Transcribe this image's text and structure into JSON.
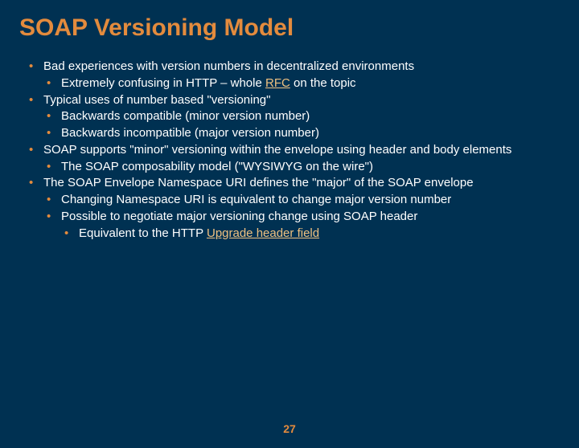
{
  "title": "SOAP Versioning Model",
  "b": {
    "i1": "Bad experiences with version numbers in decentralized environments",
    "i1a_pre": "Extremely confusing in HTTP – whole ",
    "i1a_link": "RFC",
    "i1a_post": " on the topic",
    "i2": "Typical uses of number based \"versioning\"",
    "i2a": "Backwards compatible (minor version number)",
    "i2b": "Backwards incompatible (major version number)",
    "i3": "SOAP supports \"minor\" versioning within the envelope using header and body elements",
    "i3a": "The SOAP composability model (\"WYSIWYG on the wire\")",
    "i4": "The SOAP Envelope Namespace URI defines the \"major\" of the SOAP envelope",
    "i4a": "Changing Namespace URI is equivalent to change major version number",
    "i4b": "Possible to negotiate major versioning change using SOAP header",
    "i4b1_pre": "Equivalent to the HTTP ",
    "i4b1_link": "Upgrade header field"
  },
  "page_number": "27"
}
